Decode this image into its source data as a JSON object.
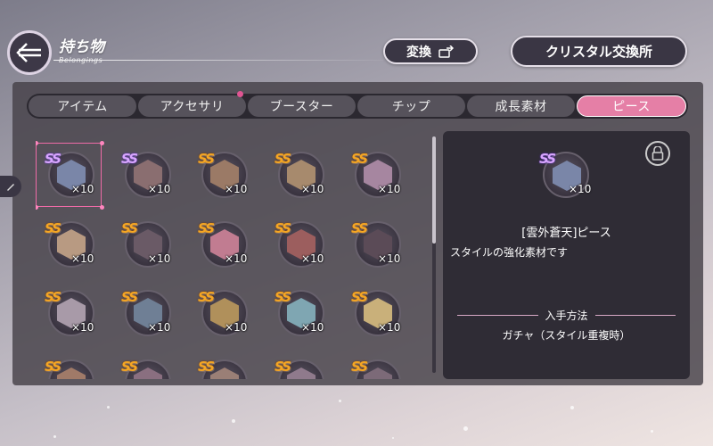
{
  "header": {
    "title": "持ち物",
    "subtitle": "Belongings",
    "back_icon": "arrow-left-icon"
  },
  "buttons": {
    "convert_label": "変換",
    "crystal_label": "クリスタル交換所"
  },
  "tabs": [
    {
      "label": "アイテム",
      "active": false,
      "notify": false
    },
    {
      "label": "アクセサリ",
      "active": false,
      "notify": true
    },
    {
      "label": "ブースター",
      "active": false,
      "notify": false
    },
    {
      "label": "チップ",
      "active": false,
      "notify": false
    },
    {
      "label": "成長素材",
      "active": false,
      "notify": false
    },
    {
      "label": "ピース",
      "active": true,
      "notify": false
    }
  ],
  "colors": {
    "accent": "#e57fa6",
    "panel": "#46414a"
  },
  "pieces": [
    {
      "rank": "SS",
      "tier": "rainbow",
      "count": "×10",
      "color": "#7a86a8",
      "selected": true
    },
    {
      "rank": "SS",
      "tier": "rainbow",
      "count": "×10",
      "color": "#8a6e70"
    },
    {
      "rank": "SS",
      "tier": "gold",
      "count": "×10",
      "color": "#9b7a66"
    },
    {
      "rank": "SS",
      "tier": "gold",
      "count": "×10",
      "color": "#a78a6d"
    },
    {
      "rank": "SS",
      "tier": "gold",
      "count": "×10",
      "color": "#a686a0"
    },
    {
      "rank": "SS",
      "tier": "gold",
      "count": "×10",
      "color": "#b89a82"
    },
    {
      "rank": "SS",
      "tier": "gold",
      "count": "×10",
      "color": "#6a5a66"
    },
    {
      "rank": "SS",
      "tier": "gold",
      "count": "×10",
      "color": "#c17c91"
    },
    {
      "rank": "SS",
      "tier": "gold",
      "count": "×10",
      "color": "#9c5e5e"
    },
    {
      "rank": "SS",
      "tier": "gold",
      "count": "×10",
      "color": "#5b4b57"
    },
    {
      "rank": "SS",
      "tier": "gold",
      "count": "×10",
      "color": "#a89aa8"
    },
    {
      "rank": "SS",
      "tier": "gold",
      "count": "×10",
      "color": "#6f7f95"
    },
    {
      "rank": "SS",
      "tier": "gold",
      "count": "×10",
      "color": "#b0905b"
    },
    {
      "rank": "SS",
      "tier": "gold",
      "count": "×10",
      "color": "#7fa6b2"
    },
    {
      "rank": "SS",
      "tier": "gold",
      "count": "×10",
      "color": "#c9b07a"
    },
    {
      "rank": "SS",
      "tier": "gold",
      "count": "",
      "color": "#a07a68"
    },
    {
      "rank": "SS",
      "tier": "gold",
      "count": "",
      "color": "#8a6f80"
    },
    {
      "rank": "SS",
      "tier": "gold",
      "count": "",
      "color": "#9a7f76"
    },
    {
      "rank": "SS",
      "tier": "gold",
      "count": "",
      "color": "#8f7a8c"
    },
    {
      "rank": "SS",
      "tier": "gold",
      "count": "",
      "color": "#7c6a78"
    }
  ],
  "detail": {
    "rank": "SS",
    "count": "×10",
    "name": "[雲外蒼天]ピース",
    "description": "スタイルの強化素材です",
    "acquire_heading": "入手方法",
    "acquire_value": "ガチャ（スタイル重複時）",
    "lock_icon": "lock-icon"
  }
}
